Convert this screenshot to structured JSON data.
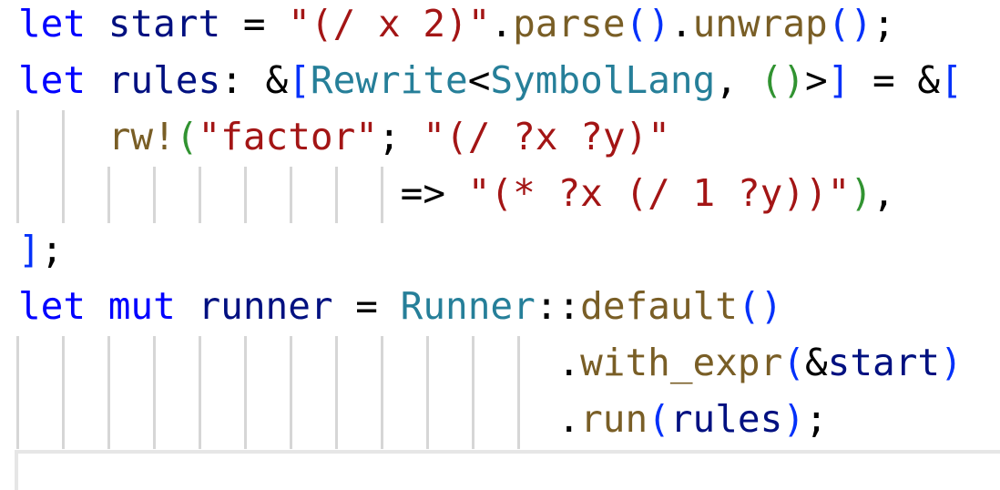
{
  "code_lines": [
    {
      "indent_guides": 0,
      "tokens": [
        {
          "t": "let",
          "c": "kw"
        },
        {
          "t": " ",
          "c": "op"
        },
        {
          "t": "start",
          "c": "var"
        },
        {
          "t": " = ",
          "c": "op"
        },
        {
          "t": "\"(/ x 2)\"",
          "c": "str"
        },
        {
          "t": ".",
          "c": "op"
        },
        {
          "t": "parse",
          "c": "fn"
        },
        {
          "t": "()",
          "c": "b1"
        },
        {
          "t": ".",
          "c": "op"
        },
        {
          "t": "unwrap",
          "c": "fn"
        },
        {
          "t": "()",
          "c": "b1"
        },
        {
          "t": ";",
          "c": "op"
        }
      ]
    },
    {
      "indent_guides": 0,
      "tokens": [
        {
          "t": "let",
          "c": "kw"
        },
        {
          "t": " ",
          "c": "op"
        },
        {
          "t": "rules",
          "c": "var"
        },
        {
          "t": ": &",
          "c": "op"
        },
        {
          "t": "[",
          "c": "b1"
        },
        {
          "t": "Rewrite",
          "c": "ty"
        },
        {
          "t": "<",
          "c": "op"
        },
        {
          "t": "SymbolLang",
          "c": "ty"
        },
        {
          "t": ", ",
          "c": "op"
        },
        {
          "t": "()",
          "c": "b2"
        },
        {
          "t": ">",
          "c": "op"
        },
        {
          "t": "]",
          "c": "b1"
        },
        {
          "t": " = &",
          "c": "op"
        },
        {
          "t": "[",
          "c": "b1"
        }
      ]
    },
    {
      "indent_guides": 2,
      "tokens": [
        {
          "t": "    ",
          "c": "op"
        },
        {
          "t": "rw!",
          "c": "fn"
        },
        {
          "t": "(",
          "c": "b2"
        },
        {
          "t": "\"factor\"",
          "c": "str"
        },
        {
          "t": "; ",
          "c": "op"
        },
        {
          "t": "\"(/ ?x ?y)\"",
          "c": "str"
        }
      ]
    },
    {
      "indent_guides": 9,
      "tokens": [
        {
          "t": "                 ",
          "c": "op"
        },
        {
          "t": "=> ",
          "c": "op"
        },
        {
          "t": "\"(* ?x (/ 1 ?y))\"",
          "c": "str"
        },
        {
          "t": ")",
          "c": "b2"
        },
        {
          "t": ",",
          "c": "op"
        }
      ]
    },
    {
      "indent_guides": 0,
      "tokens": [
        {
          "t": "]",
          "c": "b1"
        },
        {
          "t": ";",
          "c": "op"
        }
      ]
    },
    {
      "indent_guides": 0,
      "tokens": [
        {
          "t": "let",
          "c": "kw"
        },
        {
          "t": " ",
          "c": "op"
        },
        {
          "t": "mut",
          "c": "kw"
        },
        {
          "t": " ",
          "c": "op"
        },
        {
          "t": "runner",
          "c": "var"
        },
        {
          "t": " = ",
          "c": "op"
        },
        {
          "t": "Runner",
          "c": "ty"
        },
        {
          "t": "::",
          "c": "op"
        },
        {
          "t": "default",
          "c": "fn"
        },
        {
          "t": "()",
          "c": "b1"
        }
      ]
    },
    {
      "indent_guides": 12,
      "tokens": [
        {
          "t": "                        ",
          "c": "op"
        },
        {
          "t": ".",
          "c": "op"
        },
        {
          "t": "with_expr",
          "c": "fn"
        },
        {
          "t": "(",
          "c": "b1"
        },
        {
          "t": "&",
          "c": "op"
        },
        {
          "t": "start",
          "c": "var"
        },
        {
          "t": ")",
          "c": "b1"
        }
      ]
    },
    {
      "indent_guides": 12,
      "tokens": [
        {
          "t": "                        ",
          "c": "op"
        },
        {
          "t": ".",
          "c": "op"
        },
        {
          "t": "run",
          "c": "fn"
        },
        {
          "t": "(",
          "c": "b1"
        },
        {
          "t": "rules",
          "c": "var"
        },
        {
          "t": ")",
          "c": "b1"
        },
        {
          "t": ";",
          "c": "op"
        }
      ]
    }
  ]
}
